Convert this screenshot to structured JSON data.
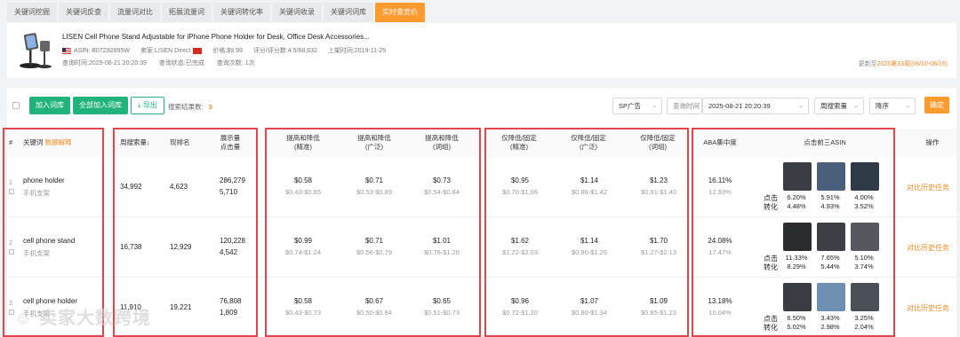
{
  "tabs": [
    "关键词挖掘",
    "关键词反查",
    "流量词对比",
    "拓展流量词",
    "关键词转化率",
    "关键词收录",
    "关键词词库",
    "实时查竞价"
  ],
  "product": {
    "title": "LISEN Cell Phone Stand Adjustable for iPhone Phone Holder for Desk, Office Desk Accessories...",
    "asin": "ASIN: B07Z82895W",
    "seller": "卖家:LISEN Direct",
    "price": "价格:$9.99",
    "rating": "评分/评分数:4.5/68,632",
    "listed": "上架时间:2019-11-25",
    "query_time": "查询时间:2025-08-21 20:20:39",
    "query_status": "查询状态:已完成",
    "query_count": "查询次数: 1次",
    "update_prefix": "更新至",
    "update_value": "2025第33周(08/10-08/16)"
  },
  "toolbar": {
    "add_label": "加入词库",
    "add_all_label": "全部加入词库",
    "export_label": "导出",
    "results_label": "搜索结果数:",
    "results_count": "3",
    "ad_type": "SP广告",
    "query_time_label": "查询时间",
    "query_time_value": "2025-08-21 20:20:39",
    "sort_field": "周搜索量",
    "sort_order": "降序",
    "confirm_label": "确定"
  },
  "headers": {
    "idx": "#",
    "keyword": "关键词",
    "keyword_link": "数据解释",
    "weekly_search": "周搜索量↓",
    "current_rank": "现排名",
    "impr1": "展示量",
    "impr2": "点击量",
    "up_down_exact": [
      "提高和降低",
      "(精准)"
    ],
    "up_down_broad": [
      "提高和降低",
      "(广泛)"
    ],
    "up_down_phrase": [
      "提高和降低",
      "(词组)"
    ],
    "down_fixed_exact": [
      "仅降低/固定",
      "(精准)"
    ],
    "down_fixed_broad": [
      "仅降低/固定",
      "(广泛)"
    ],
    "down_fixed_phrase": [
      "仅降低/固定",
      "(词组)"
    ],
    "aba": "ABA集中度",
    "top3": "点击前三ASIN",
    "action": "操作"
  },
  "rows": [
    {
      "idx": "1",
      "keyword": "phone holder",
      "keyword_cn": "手机支架",
      "weekly_search": "34,992",
      "rank": "4,623",
      "impressions": "286,279",
      "clicks": "5,710",
      "ud_exact": "$0.58",
      "ud_exact_r": "$0.43-$0.65",
      "ud_broad": "$0.71",
      "ud_broad_r": "$0.53-$0.89",
      "ud_phrase": "$0.73",
      "ud_phrase_r": "$0.54-$0.84",
      "df_exact": "$0.95",
      "df_exact_r": "$0.70-$1.06",
      "df_broad": "$1.14",
      "df_broad_r": "$0.86-$1.42",
      "df_phrase": "$1.23",
      "df_phrase_r": "$0.91-$1.40",
      "aba1": "16.11%",
      "aba2": "12.93%",
      "clk": [
        "6.20%",
        "5.91%",
        "4.00%"
      ],
      "cvr": [
        "4.48%",
        "4.93%",
        "3.52%"
      ],
      "action": "对比历史任务"
    },
    {
      "idx": "2",
      "keyword": "cell phone stand",
      "keyword_cn": "手机支架",
      "weekly_search": "16,738",
      "rank": "12,929",
      "impressions": "120,228",
      "clicks": "4,542",
      "ud_exact": "$0.99",
      "ud_exact_r": "$0.74-$1.24",
      "ud_broad": "$0.71",
      "ud_broad_r": "$0.56-$0.79",
      "ud_phrase": "$1.01",
      "ud_phrase_r": "$0.76-$1.26",
      "df_exact": "$1.62",
      "df_exact_r": "$1.22-$2.03",
      "df_broad": "$1.14",
      "df_broad_r": "$0.90-$1.26",
      "df_phrase": "$1.70",
      "df_phrase_r": "$1.27-$2.13",
      "aba1": "24.08%",
      "aba2": "17.47%",
      "clk": [
        "11.33%",
        "7.65%",
        "5.10%"
      ],
      "cvr": [
        "8.29%",
        "5.44%",
        "3.74%"
      ],
      "action": "对比历史任务"
    },
    {
      "idx": "3",
      "keyword": "cell phone holder",
      "keyword_cn": "手机支架",
      "weekly_search": "11,910",
      "rank": "19,221",
      "impressions": "76,808",
      "clicks": "1,809",
      "ud_exact": "$0.58",
      "ud_exact_r": "$0.43-$0.73",
      "ud_broad": "$0.67",
      "ud_broad_r": "$0.50-$0.84",
      "ud_phrase": "$0.65",
      "ud_phrase_r": "$0.51-$0.73",
      "df_exact": "$0.96",
      "df_exact_r": "$0.72-$1.20",
      "df_broad": "$1.07",
      "df_broad_r": "$0.80-$1.34",
      "df_phrase": "$1.09",
      "df_phrase_r": "$0.85-$1.23",
      "aba1": "13.18%",
      "aba2": "10.04%",
      "clk": [
        "6.50%",
        "3.43%",
        "3.25%"
      ],
      "cvr": [
        "5.02%",
        "2.98%",
        "2.04%"
      ],
      "action": "对比历史任务"
    }
  ],
  "labels": {
    "click": "点击",
    "conv": "转化"
  },
  "watermark": "卖家大数跨境",
  "colors": {
    "accent": "#ff9a2e",
    "green": "#21b37a",
    "highlight_box": "#e2454a"
  }
}
